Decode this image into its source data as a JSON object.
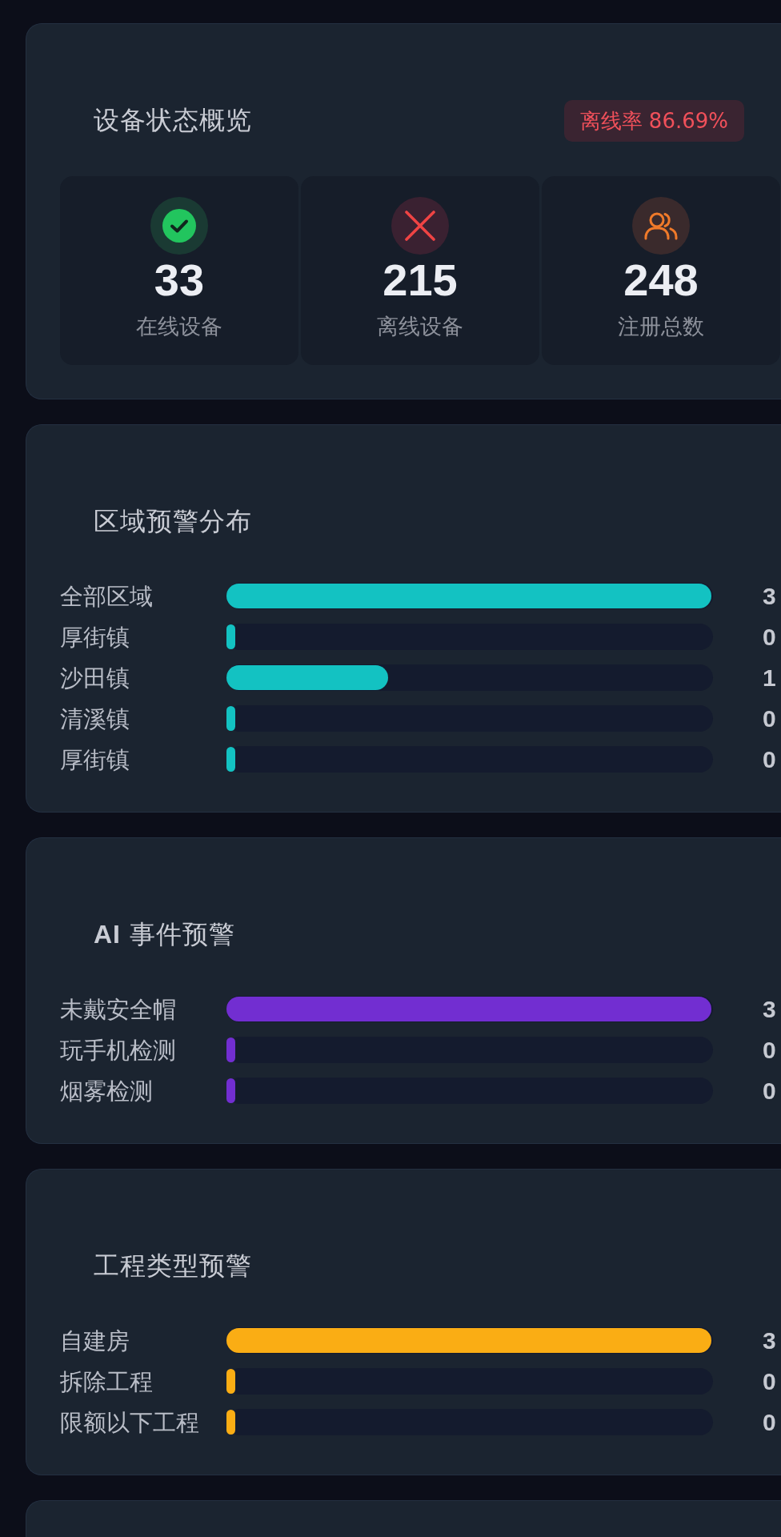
{
  "overview": {
    "title": "设备状态概览",
    "badge": "离线率 86.69%",
    "stats": [
      {
        "kind": "online",
        "value": "33",
        "label": "在线设备"
      },
      {
        "kind": "offline",
        "value": "215",
        "label": "离线设备"
      },
      {
        "kind": "total",
        "value": "248",
        "label": "注册总数"
      }
    ]
  },
  "panels": [
    {
      "title": "区域预警分布",
      "color": "#13c2c2",
      "rows": [
        {
          "label": "全部区域",
          "level": 1,
          "value": "3"
        },
        {
          "label": "厚街镇",
          "level": 0,
          "value": "0"
        },
        {
          "label": "沙田镇",
          "level": 0.333,
          "value": "1"
        },
        {
          "label": "清溪镇",
          "level": 0,
          "value": "0"
        },
        {
          "label": "厚街镇",
          "level": 0,
          "value": "0"
        }
      ]
    },
    {
      "title": "**AI** 事件预警",
      "color": "#722ed1",
      "rows": [
        {
          "label": "未戴安全帽",
          "level": 1,
          "value": "3"
        },
        {
          "label": "玩手机检测",
          "level": 0,
          "value": "0"
        },
        {
          "label": "烟雾检测",
          "level": 0,
          "value": "0"
        }
      ]
    },
    {
      "title": "工程类型预警",
      "color": "#faad14",
      "rows": [
        {
          "label": "自建房",
          "level": 1,
          "value": "3"
        },
        {
          "label": "拆除工程",
          "level": 0,
          "value": "0"
        },
        {
          "label": "限额以下工程",
          "level": 0,
          "value": "0"
        }
      ]
    }
  ]
}
